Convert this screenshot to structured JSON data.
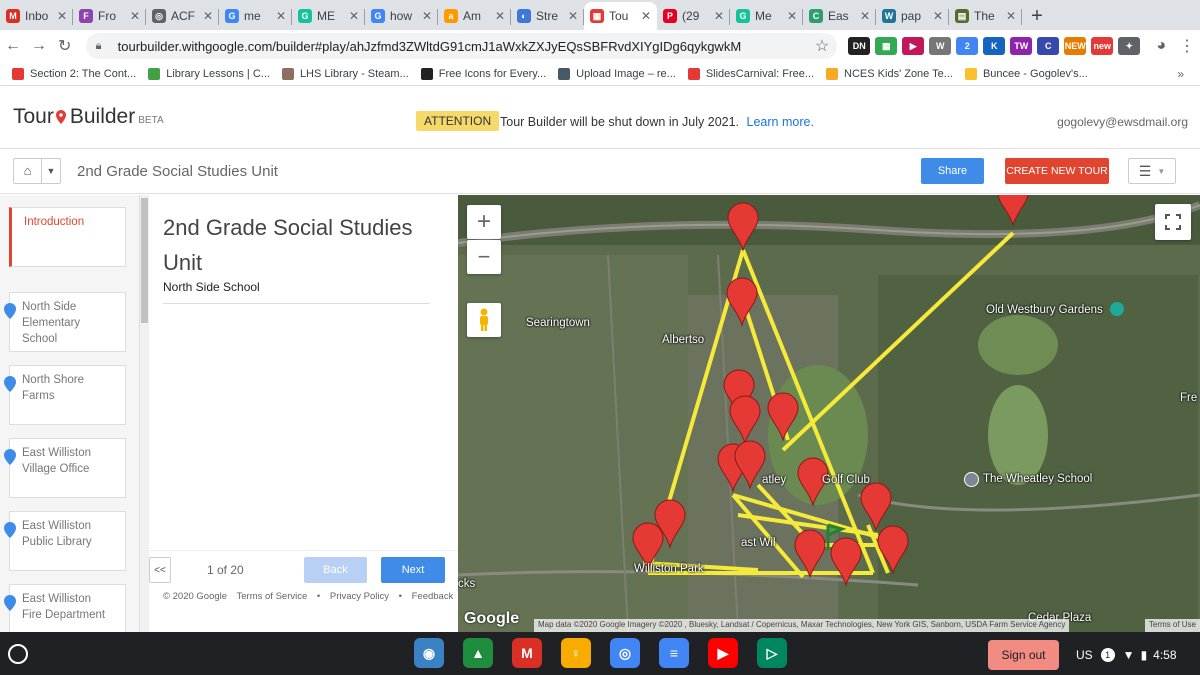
{
  "browser": {
    "tabs": [
      {
        "title": "Inbo",
        "icon": "gmail-icon",
        "color": "#d93025",
        "glyph": "M"
      },
      {
        "title": "Fro",
        "icon": "purple-logo-icon",
        "color": "#8e44ad",
        "glyph": "F"
      },
      {
        "title": "ACF",
        "icon": "globe-icon",
        "color": "#5f6368",
        "glyph": "◎"
      },
      {
        "title": "me",
        "icon": "google-icon",
        "color": "#4285f4",
        "glyph": "G"
      },
      {
        "title": "ME",
        "icon": "grammarly-icon",
        "color": "#15c39a",
        "glyph": "G"
      },
      {
        "title": "how",
        "icon": "google-icon",
        "color": "#4285f4",
        "glyph": "G"
      },
      {
        "title": "Am",
        "icon": "amazon-icon",
        "color": "#ff9900",
        "glyph": "a"
      },
      {
        "title": "Stre",
        "icon": "stream-icon",
        "color": "#3f78d8",
        "glyph": "◐"
      },
      {
        "title": "Tou",
        "icon": "tour-builder-icon",
        "color": "#e53935",
        "glyph": "▦",
        "active": true
      },
      {
        "title": "(29",
        "icon": "pinterest-icon",
        "color": "#e60023",
        "glyph": "P"
      },
      {
        "title": "Me",
        "icon": "grammarly-icon",
        "color": "#15c39a",
        "glyph": "G"
      },
      {
        "title": "Eas",
        "icon": "c-logo-icon",
        "color": "#2e9d6f",
        "glyph": "C"
      },
      {
        "title": "pap",
        "icon": "wordpress-icon",
        "color": "#21759b",
        "glyph": "W"
      },
      {
        "title": "The",
        "icon": "page-thumbnail-icon",
        "color": "#556b2f",
        "glyph": "▤"
      }
    ],
    "new_tab": "+",
    "url": "tourbuilder.withgoogle.com/builder#play/ahJzfmd3ZWltdG91cmJ1aWxkZXJyEQsSBFRvdXIYgIDg6qykgwkM",
    "extensions": [
      {
        "icon": "dn-extension-icon",
        "label": "DN",
        "color": "#222"
      },
      {
        "icon": "green-extension-icon",
        "label": "▦",
        "color": "#34a853"
      },
      {
        "icon": "screencast-extension-icon",
        "label": "▶",
        "color": "#c2185b"
      },
      {
        "icon": "w-extension-icon",
        "label": "W",
        "color": "#777"
      },
      {
        "icon": "badge-extension-icon",
        "label": "2",
        "color": "#4285f4"
      },
      {
        "icon": "k-extension-icon",
        "label": "K",
        "color": "#1565c0"
      },
      {
        "icon": "tw-extension-icon",
        "label": "TW",
        "color": "#8e24aa"
      },
      {
        "icon": "c-extension-icon",
        "label": "C",
        "color": "#3949ab"
      },
      {
        "icon": "new-extension-icon",
        "label": "NEW",
        "color": "#e67c00"
      },
      {
        "icon": "new-extension-icon",
        "label": "new",
        "color": "#e53935"
      },
      {
        "icon": "puzzle-icon",
        "label": "✦",
        "color": "#5f6368"
      }
    ],
    "bookmarks": [
      {
        "label": "Section 2: The Cont...",
        "color": "#e53935"
      },
      {
        "label": "Library Lessons | C...",
        "color": "#43a047"
      },
      {
        "label": "LHS Library - Steam...",
        "color": "#8d6e63"
      },
      {
        "label": "Free Icons for Every...",
        "color": "#222"
      },
      {
        "label": "Upload Image – re...",
        "color": "#455a64"
      },
      {
        "label": "SlidesCarnival: Free...",
        "color": "#e53935"
      },
      {
        "label": "NCES Kids' Zone Te...",
        "color": "#f9a825"
      },
      {
        "label": "Buncee - Gogolev's...",
        "color": "#fbc02d"
      }
    ]
  },
  "app": {
    "logo_part1": "Tour",
    "logo_part2": "Builder",
    "beta": "BETA",
    "attention_badge": "ATTENTION",
    "attention_text": "Tour Builder will be shut down in July 2021.",
    "learn_more": "Learn more.",
    "user_email": "gogolevy@ewsdmail.org",
    "tour_title": "2nd Grade Social Studies Unit",
    "share_label": "Share",
    "create_label": "CREATE NEW TOUR"
  },
  "sidebar": {
    "items": [
      {
        "label": "Introduction",
        "intro": true
      },
      {
        "label": "North Side Elementary School"
      },
      {
        "label": "North Shore Farms"
      },
      {
        "label": "East Williston Village Office"
      },
      {
        "label": "East Williston Public Library"
      },
      {
        "label": "East Williston Fire Department"
      }
    ]
  },
  "panel": {
    "title": "2nd Grade Social Studies Unit",
    "subtitle": "North Side School",
    "prev_label": "<<",
    "page_count": "1 of 20",
    "back_label": "Back",
    "next_label": "Next",
    "footer": [
      "© 2020 Google",
      "Terms of Service",
      "•",
      "Privacy Policy",
      "•",
      "Feedback"
    ]
  },
  "map": {
    "zoom_in": "+",
    "zoom_out": "−",
    "labels": [
      "Searingtown",
      "Albertso",
      "Old Westbury Gardens",
      "Fre",
      "The Wheatley School",
      "atley",
      "Golf Club",
      "ast Wil",
      "Williston Park",
      "cks",
      "Cedar Plaza"
    ],
    "google": "Google",
    "attribution": "Map data ©2020 Google Imagery ©2020 , Bluesky, Landsat / Copernicus, Maxar Technologies, New York GIS, Sanborn, USDA Farm Service Agency",
    "terms": "Terms of Use",
    "route_color": "#f5e93a",
    "marker_color": "#e53935"
  },
  "taskbar": {
    "apps": [
      {
        "icon": "world-app-icon",
        "color": "#3b82c4",
        "glyph": "◉"
      },
      {
        "icon": "google-drive-icon",
        "color": "#1e8e3e",
        "glyph": "▲"
      },
      {
        "icon": "gmail-app-icon",
        "color": "#d93025",
        "glyph": "M"
      },
      {
        "icon": "keep-icon",
        "color": "#f9ab00",
        "glyph": "♀"
      },
      {
        "icon": "chrome-icon",
        "color": "#4285f4",
        "glyph": "◎"
      },
      {
        "icon": "google-docs-icon",
        "color": "#4285f4",
        "glyph": "≡"
      },
      {
        "icon": "youtube-icon",
        "color": "#ff0000",
        "glyph": "▶"
      },
      {
        "icon": "play-store-icon",
        "color": "#01875f",
        "glyph": "▷"
      }
    ],
    "sign_out": "Sign out",
    "locale": "US",
    "notifications": "1",
    "wifi": "▼",
    "battery": "▮",
    "time": "4:58"
  }
}
